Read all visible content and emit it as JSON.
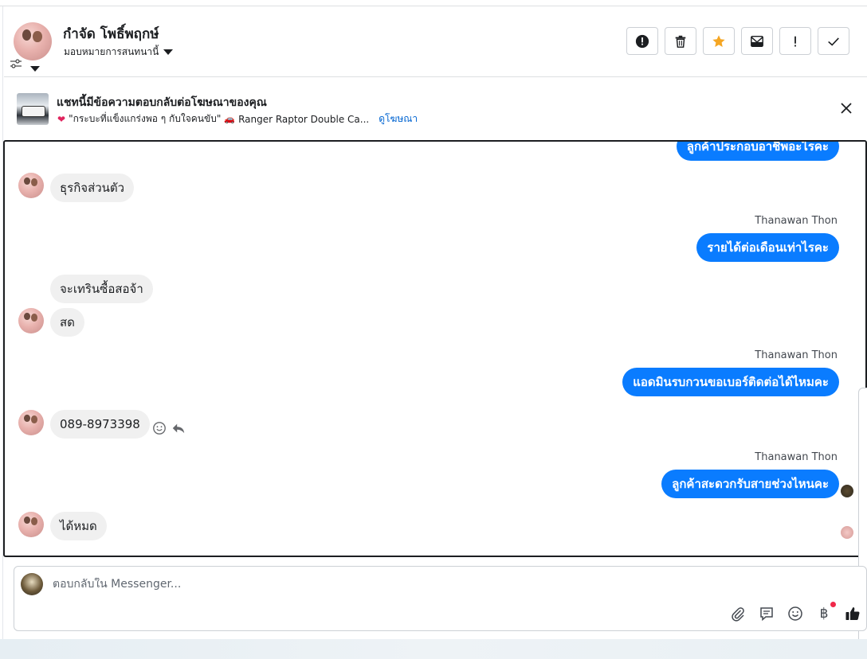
{
  "header": {
    "contact_name": "กำจัด โพธิ์พฤกษ์",
    "assign_label": "มอบหมายการสนทนานี้",
    "actions": [
      {
        "name": "report-button",
        "icon": "alert-circle-icon"
      },
      {
        "name": "delete-button",
        "icon": "trash-icon"
      },
      {
        "name": "star-button",
        "icon": "star-icon"
      },
      {
        "name": "mark-unread-button",
        "icon": "envelope-icon"
      },
      {
        "name": "important-button",
        "icon": "exclamation-icon"
      },
      {
        "name": "done-button",
        "icon": "check-icon"
      }
    ]
  },
  "ad": {
    "title": "แชทนี้มีข้อความตอบกลับต่อโฆษณาของคุณ",
    "caption": "\"กระบะที่แข็งแกร่งพอ ๆ กับใจคนขับ\"",
    "product": "Ranger Raptor Double Ca...",
    "link_label": "ดูโฆษณา"
  },
  "messages": [
    {
      "dir": "out",
      "text": "ลูกค้าประกอบอาชีพอะไรคะ"
    },
    {
      "dir": "in",
      "text": "ธุรกิจส่วนตัว"
    },
    {
      "dir": "out",
      "sender": "Thanawan Thon",
      "text": "รายได้ต่อเดือนเท่าไรคะ"
    },
    {
      "dir": "in",
      "text": "จะเทรินซื้อสอจ้า"
    },
    {
      "dir": "in",
      "text": "สด"
    },
    {
      "dir": "out",
      "sender": "Thanawan Thon",
      "text": "แอดมินรบกวนขอเบอร์ติดต่อได้ไหมคะ"
    },
    {
      "dir": "in",
      "text": "089-8973398"
    },
    {
      "dir": "out",
      "sender": "Thanawan Thon",
      "text": "ลูกค้าสะดวกรับสายช่วงไหนคะ"
    },
    {
      "dir": "in",
      "text": "ได้หมด"
    }
  ],
  "composer": {
    "placeholder": "ตอบกลับใน Messenger...",
    "baht_symbol": "฿"
  },
  "colors": {
    "outgoing_bubble": "#0a7cff",
    "incoming_bubble": "#f0f0f0",
    "star": "#f5a623",
    "link": "#0064d1",
    "notification_dot": "#f02849"
  }
}
